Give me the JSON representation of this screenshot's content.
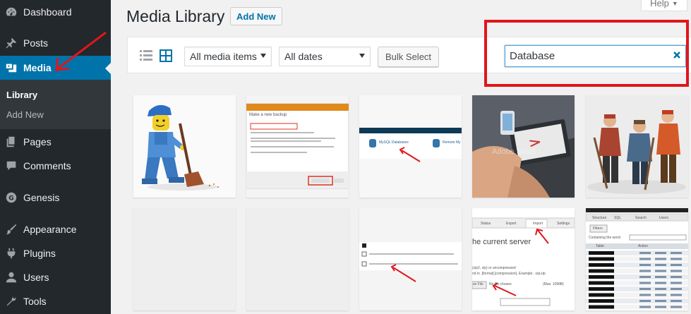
{
  "sidebar": {
    "items": [
      {
        "label": "Dashboard",
        "icon": "dashboard-icon"
      },
      {
        "label": "Posts",
        "icon": "pin-icon"
      },
      {
        "label": "Media",
        "icon": "media-icon"
      },
      {
        "label": "Pages",
        "icon": "pages-icon"
      },
      {
        "label": "Comments",
        "icon": "comment-icon"
      },
      {
        "label": "Genesis",
        "icon": "genesis-icon"
      },
      {
        "label": "Appearance",
        "icon": "brush-icon"
      },
      {
        "label": "Plugins",
        "icon": "plugin-icon"
      },
      {
        "label": "Users",
        "icon": "user-icon"
      },
      {
        "label": "Tools",
        "icon": "wrench-icon"
      }
    ],
    "submenu": [
      "Library",
      "Add New"
    ]
  },
  "header": {
    "title": "Media Library",
    "add_new": "Add New",
    "help": "Help"
  },
  "toolbar": {
    "filter_type": "All media items",
    "filter_date": "All dates",
    "bulk_select": "Bulk Select",
    "search_value": "Database"
  },
  "tiles": {
    "t2_dialog_title": "Make a new backup",
    "t2_btn": "Backup Now",
    "t2_cancel": "Cancel",
    "t3_label1": "MySQL Databases",
    "t3_label2": "Remote My",
    "t4_watermark": "Adobe Stock",
    "t9_tab1": "Status",
    "t9_tab2": "Export",
    "t9_tab3": "Import",
    "t9_tab4": "Settings",
    "t9_heading": "he current server",
    "t9_line1": "(zip2, zip) or uncompressed",
    "t9_line2": "nd in .[format].[compression]. Example: .sql.zip",
    "t9_file": "se File",
    "t9_nofile": "No file chosen",
    "t9_max": "(Max: 10MiB)",
    "t10_tab1": "Structure",
    "t10_tab2": "SQL",
    "t10_tab3": "Search",
    "t10_tab4": "Users",
    "t10_filters": "Filters",
    "t10_containing": "Containing the word:",
    "t10_col1": "Table",
    "t10_col2": "Action"
  },
  "colors": {
    "sidebar_bg": "#23282d",
    "active_bg": "#0073aa",
    "highlight": "#e0161c"
  }
}
